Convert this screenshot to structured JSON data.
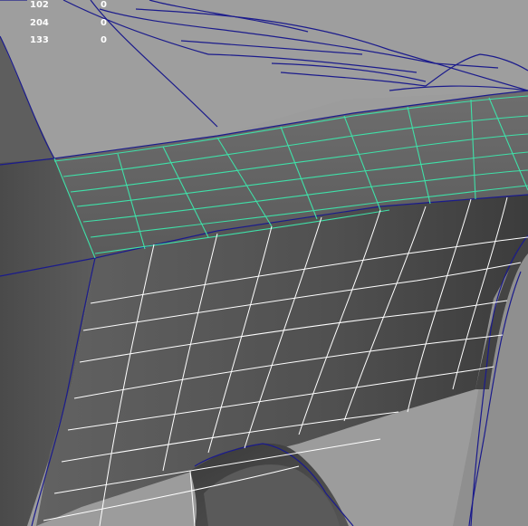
{
  "viewport": {
    "hud": {
      "rows": [
        {
          "label": "102",
          "value": "0"
        },
        {
          "label": "204",
          "value": "0"
        },
        {
          "label": "133",
          "value": "0"
        }
      ]
    },
    "colors": {
      "background": "#999999",
      "surface_dark": "#4a4a4a",
      "surface_mid": "#6a6a6a",
      "selected_wire": "#3fe0a8",
      "wire": "#ffffff",
      "edge": "#1a1a8a"
    }
  }
}
